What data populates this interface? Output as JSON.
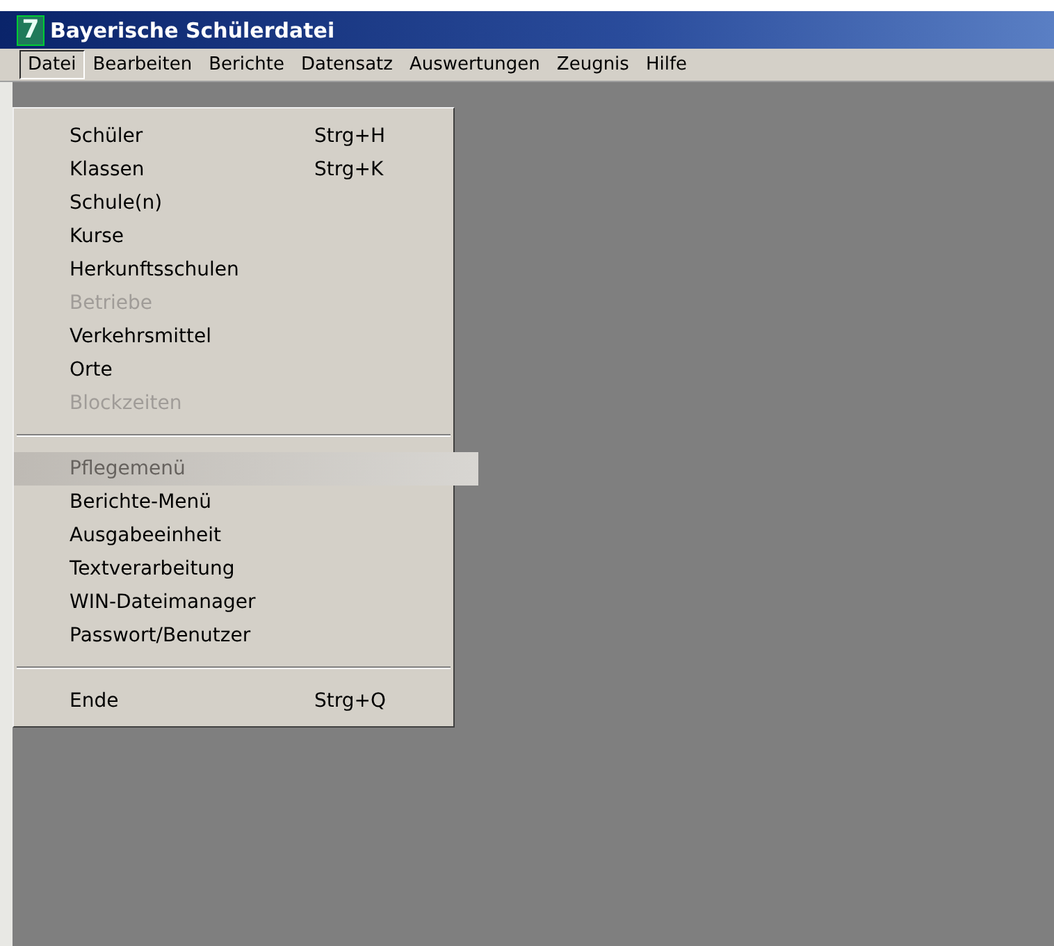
{
  "window": {
    "title": "Bayerische Schülerdatei",
    "app_icon": "7"
  },
  "menu_bar": [
    {
      "label": "Datei",
      "selected": true
    },
    {
      "label": "Bearbeiten",
      "selected": false
    },
    {
      "label": "Berichte",
      "selected": false
    },
    {
      "label": "Datensatz",
      "selected": false
    },
    {
      "label": "Auswertungen",
      "selected": false
    },
    {
      "label": "Zeugnis",
      "selected": false
    },
    {
      "label": "Hilfe",
      "selected": false
    }
  ],
  "dropdown": [
    {
      "kind": "item",
      "label": "Schüler",
      "shortcut": "Strg+H",
      "disabled": false,
      "selected": false
    },
    {
      "kind": "item",
      "label": "Klassen",
      "shortcut": "Strg+K",
      "disabled": false,
      "selected": false
    },
    {
      "kind": "item",
      "label": "Schule(n)",
      "disabled": false,
      "selected": false
    },
    {
      "kind": "item",
      "label": "Kurse",
      "disabled": false,
      "selected": false
    },
    {
      "kind": "item",
      "label": "Herkunftsschulen",
      "disabled": false,
      "selected": false
    },
    {
      "kind": "item",
      "label": "Betriebe",
      "disabled": true,
      "selected": false
    },
    {
      "kind": "item",
      "label": "Verkehrsmittel",
      "disabled": false,
      "selected": false
    },
    {
      "kind": "item",
      "label": "Orte",
      "disabled": false,
      "selected": false
    },
    {
      "kind": "item",
      "label": "Blockzeiten",
      "disabled": true,
      "selected": false
    },
    {
      "kind": "separator"
    },
    {
      "kind": "item",
      "label": "Pflegemenü",
      "disabled": true,
      "selected": true
    },
    {
      "kind": "item",
      "label": "Berichte-Menü",
      "disabled": false,
      "selected": false
    },
    {
      "kind": "item",
      "label": "Ausgabeeinheit",
      "disabled": false,
      "selected": false
    },
    {
      "kind": "item",
      "label": "Textverarbeitung",
      "disabled": false,
      "selected": false
    },
    {
      "kind": "item",
      "label": "WIN-Dateimanager",
      "disabled": false,
      "selected": false
    },
    {
      "kind": "item",
      "label": "Passwort/Benutzer",
      "disabled": false,
      "selected": false
    },
    {
      "kind": "separator"
    },
    {
      "kind": "item",
      "label": "Ende",
      "shortcut": "Strg+Q",
      "disabled": false,
      "selected": false
    }
  ]
}
